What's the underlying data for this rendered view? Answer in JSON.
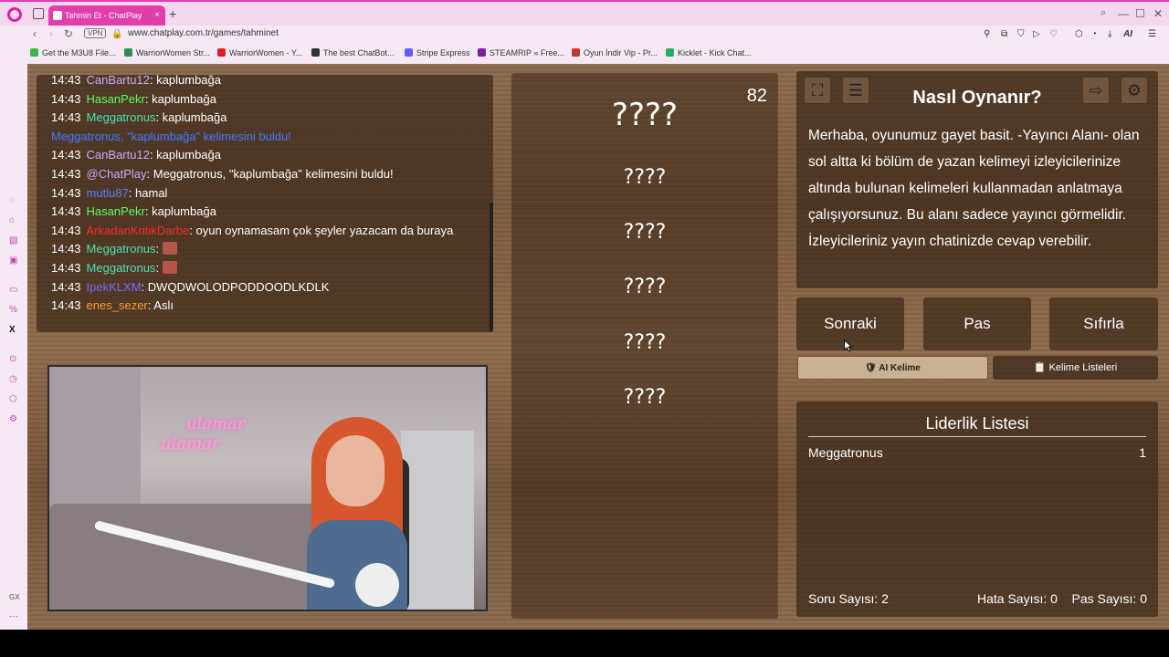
{
  "browser": {
    "tab_title": "Tahmin Et - ChatPlay",
    "tab_close": "×",
    "new_tab": "+",
    "url": "www.chatplay.com.tr/games/tahminet",
    "vpn_label": "VPN",
    "ai_label": "AI",
    "win_min": "—",
    "win_max": "☐",
    "win_close": "✕"
  },
  "bookmarks": [
    {
      "label": "Get the M3U8 File...",
      "color": "#3ab54a"
    },
    {
      "label": "WarriorWomen Str...",
      "color": "#2e8b57"
    },
    {
      "label": "WarriorWomen - Y...",
      "color": "#e02020"
    },
    {
      "label": "The best ChatBot...",
      "color": "#333333"
    },
    {
      "label": "Stripe Express",
      "color": "#635bff"
    },
    {
      "label": "STEAMRIP » Free...",
      "color": "#7a1fa2"
    },
    {
      "label": "Oyun İndir Vip - Pr...",
      "color": "#c0392b"
    },
    {
      "label": "Kicklet - Kick Chat...",
      "color": "#27ae60"
    }
  ],
  "chat": [
    {
      "time": "14:43",
      "user": "CanBartu12",
      "user_color": "#c9a6ff",
      "sep": ":",
      "msg": " kaplumbağa"
    },
    {
      "time": "14:43",
      "user": "HasanPekr",
      "user_color": "#5cff5c",
      "sep": ":",
      "msg": " kaplumbağa"
    },
    {
      "time": "14:43",
      "user": "Meggatronus",
      "user_color": "#4fe0b5",
      "sep": ":",
      "msg": " kaplumbağa"
    },
    {
      "time": "",
      "user": "Meggatronus, \"kaplumbağa\" kelimesini buldu!",
      "user_color": "#3d7bff",
      "sep": "",
      "msg": ""
    },
    {
      "time": "14:43",
      "user": "CanBartu12",
      "user_color": "#c9a6ff",
      "sep": ":",
      "msg": " kaplumbağa"
    },
    {
      "time": "14:43",
      "user": "@ChatPlay",
      "user_color": "#c9a6ff",
      "sep": ":",
      "msg": " Meggatronus, \"kaplumbağa\" kelimesini buldu!"
    },
    {
      "time": "14:43",
      "user": "mutlu87",
      "user_color": "#5a7cff",
      "sep": ":",
      "msg": " hamal"
    },
    {
      "time": "14:43",
      "user": "HasanPekr",
      "user_color": "#5cff5c",
      "sep": ":",
      "msg": " kaplumbağa"
    },
    {
      "time": "14:43",
      "user": "ArkadanKritikDarbe",
      "user_color": "#ff2a2a",
      "sep": ":",
      "msg": " oyun oynamasam çok şeyler yazacam da buraya"
    },
    {
      "time": "14:43",
      "user": "Meggatronus",
      "user_color": "#4fe0b5",
      "sep": ":",
      "msg": " "
    },
    {
      "time": "14:43",
      "user": "Meggatronus",
      "user_color": "#4fe0b5",
      "sep": ":",
      "msg": " "
    },
    {
      "time": "14:43",
      "user": "IpekKLXM",
      "user_color": "#7a6bff",
      "sep": ":",
      "msg": " DWQDWOLODPODDOODLKDLK"
    },
    {
      "time": "14:43",
      "user": "enes_sezer",
      "user_color": "#ff9e2a",
      "sep": ":",
      "msg": " Aslı"
    }
  ],
  "camera": {
    "neon_line1": "ulamar",
    "neon_line2": "ulamar"
  },
  "game": {
    "timer": "82",
    "words": [
      "????",
      "????",
      "????",
      "????",
      "????",
      "????"
    ]
  },
  "howto": {
    "title": "Nasıl Oynanır?",
    "text": "Merhaba, oyunumuz gayet basit. -Yayıncı Alanı- olan sol altta ki bölüm de yazan kelimeyi izleyicilerinize altında bulunan kelimeleri kullanmadan anlatmaya çalışıyorsunuz. Bu alanı sadece yayıncı görmelidir. İzleyicileriniz yayın chatinizde cevap verebilir."
  },
  "actions": {
    "next": "Sonraki",
    "pass": "Pas",
    "reset": "Sıfırla",
    "ai_word": "🛡 AI Kelime",
    "word_lists": "📋 Kelime Listeleri"
  },
  "leaderboard": {
    "title": "Liderlik Listesi",
    "rows": [
      {
        "name": "Meggatronus",
        "score": "1"
      }
    ],
    "question_count": "Soru Sayısı: 2",
    "error_count": "Hata Sayısı: 0",
    "pass_count": "Pas Sayısı: 0"
  }
}
